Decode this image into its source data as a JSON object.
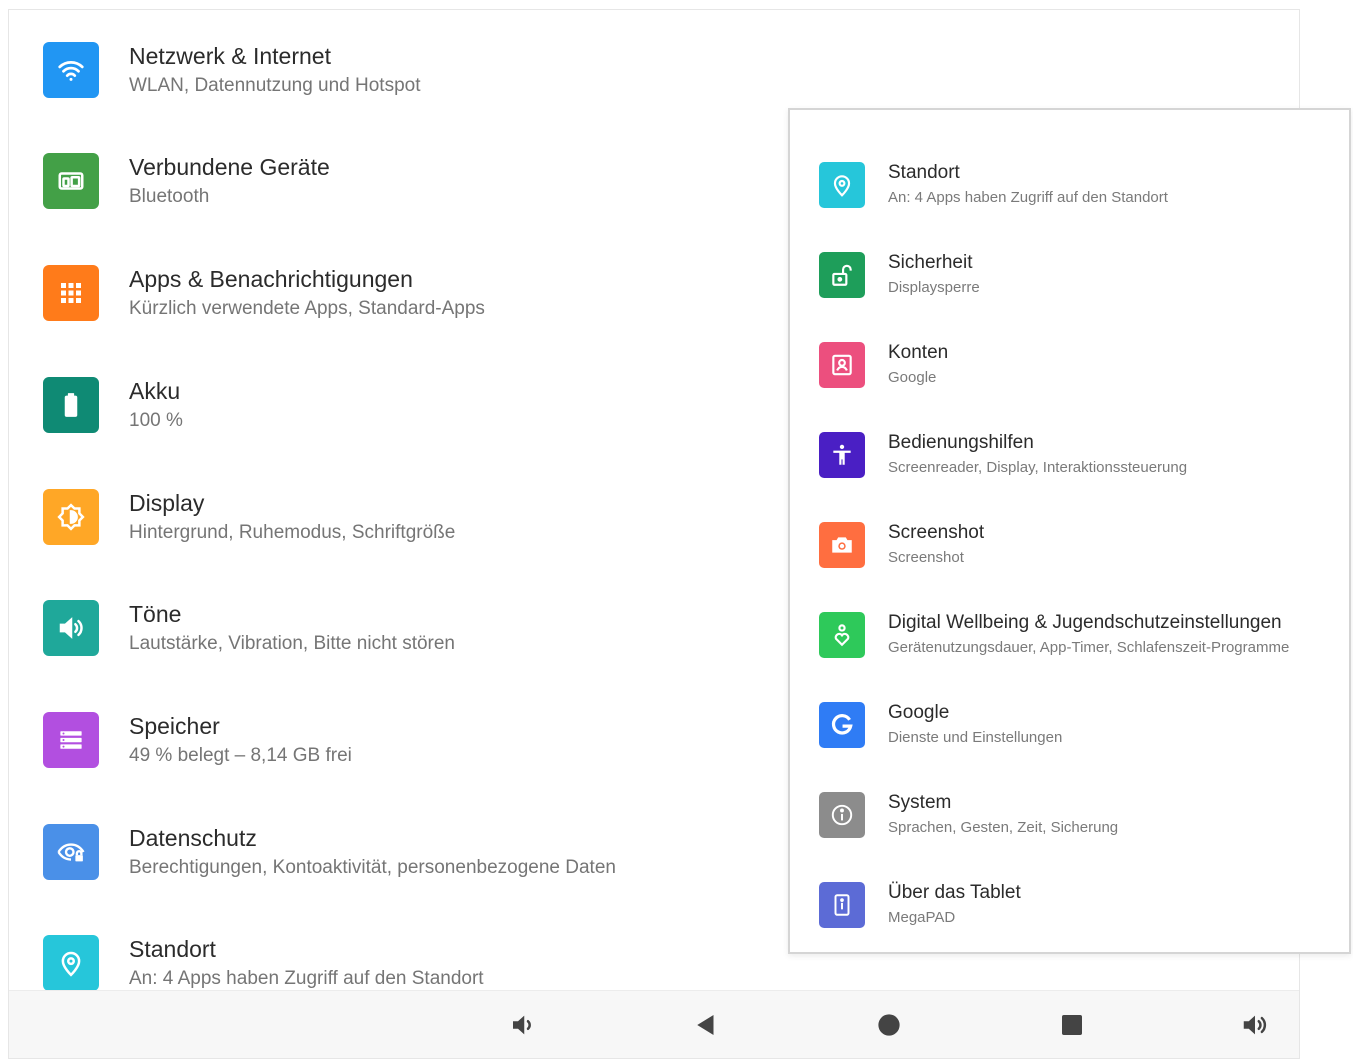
{
  "settings": {
    "items": [
      {
        "title": "Netzwerk & Internet",
        "subtitle": "WLAN, Datennutzung und Hotspot",
        "icon": "wifi-icon",
        "color": "#2196f3"
      },
      {
        "title": "Verbundene Geräte",
        "subtitle": "Bluetooth",
        "icon": "devices-icon",
        "color": "#43a047"
      },
      {
        "title": "Apps & Benachrichtigungen",
        "subtitle": "Kürzlich verwendete Apps, Standard-Apps",
        "icon": "apps-icon",
        "color": "#ff7b1a"
      },
      {
        "title": "Akku",
        "subtitle": "100 %",
        "icon": "battery-icon",
        "color": "#0f8a74"
      },
      {
        "title": "Display",
        "subtitle": "Hintergrund, Ruhemodus, Schriftgröße",
        "icon": "display-icon",
        "color": "#ffa726"
      },
      {
        "title": "Töne",
        "subtitle": "Lautstärke, Vibration, Bitte nicht stören",
        "icon": "sound-icon",
        "color": "#1fa89a"
      },
      {
        "title": "Speicher",
        "subtitle": "49 % belegt – 8,14 GB frei",
        "icon": "storage-icon",
        "color": "#b24fe0"
      },
      {
        "title": "Datenschutz",
        "subtitle": "Berechtigungen, Kontoaktivität, personenbezogene Daten",
        "icon": "privacy-icon",
        "color": "#4a90e8"
      },
      {
        "title": "Standort",
        "subtitle": "An: 4 Apps haben Zugriff auf den Standort",
        "icon": "location-icon",
        "color": "#26c6da"
      }
    ]
  },
  "panel": {
    "items": [
      {
        "title": "Standort",
        "subtitle": "An: 4 Apps haben Zugriff auf den Standort",
        "icon": "location-icon",
        "color": "#26c6da"
      },
      {
        "title": "Sicherheit",
        "subtitle": "Displaysperre",
        "icon": "lock-icon",
        "color": "#1e9e5a"
      },
      {
        "title": "Konten",
        "subtitle": "Google",
        "icon": "account-icon",
        "color": "#ec4f7e"
      },
      {
        "title": "Bedienungshilfen",
        "subtitle": "Screenreader, Display, Interaktionssteuerung",
        "icon": "accessibility-icon",
        "color": "#4a1fc4"
      },
      {
        "title": "Screenshot",
        "subtitle": "Screenshot",
        "icon": "camera-icon",
        "color": "#ff6e40"
      },
      {
        "title": "Digital Wellbeing & Jugendschutzeinstellungen",
        "subtitle": "Gerätenutzungsdauer, App-Timer, Schlafenszeit-Programme",
        "icon": "wellbeing-icon",
        "color": "#2ec95a"
      },
      {
        "title": "Google",
        "subtitle": "Dienste und Einstellungen",
        "icon": "google-icon",
        "color": "#2f7cf5"
      },
      {
        "title": "System",
        "subtitle": "Sprachen, Gesten, Zeit, Sicherung",
        "icon": "info-icon",
        "color": "#8c8c8c"
      },
      {
        "title": "Über das Tablet",
        "subtitle": "MegaPAD",
        "icon": "tablet-icon",
        "color": "#5c6bd6"
      }
    ]
  },
  "navbar": {
    "buttons": [
      "volume-down-icon",
      "back-icon",
      "home-icon",
      "recents-icon",
      "volume-up-icon"
    ]
  }
}
